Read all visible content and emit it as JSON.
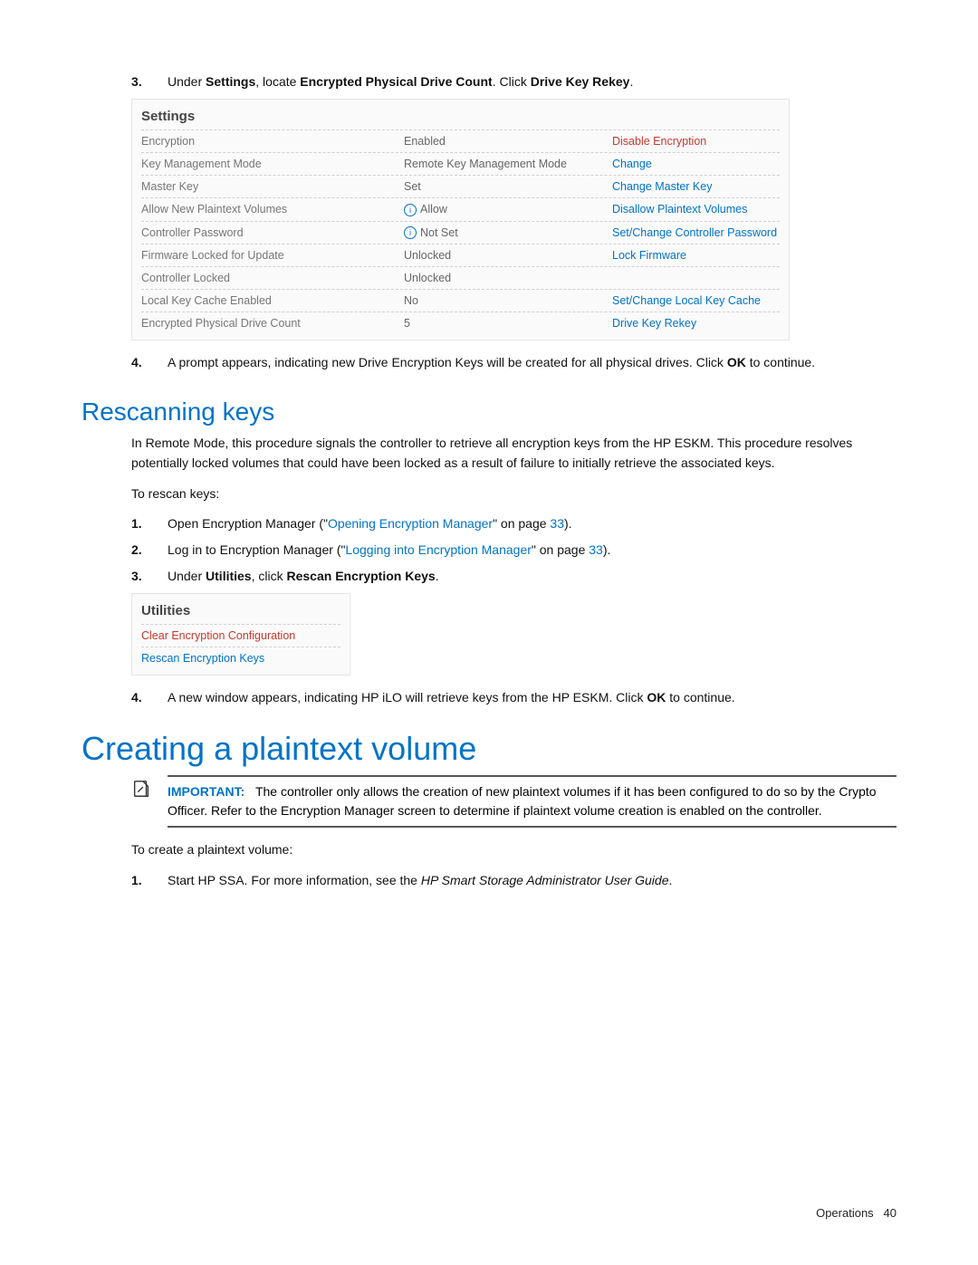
{
  "step3": {
    "num": "3.",
    "pre": "Under ",
    "b1": "Settings",
    "mid": ", locate ",
    "b2": "Encrypted Physical Drive Count",
    "mid2": ". Click ",
    "b3": "Drive Key Rekey",
    "post": "."
  },
  "settings": {
    "title": "Settings",
    "rows": [
      {
        "c1": "Encryption",
        "c2": "Enabled",
        "c3": "Disable Encryption",
        "info": false,
        "red": true
      },
      {
        "c1": "Key Management Mode",
        "c2": "Remote Key Management Mode",
        "c3": "Change",
        "info": false
      },
      {
        "c1": "Master Key",
        "c2": "Set",
        "c3": "Change Master Key",
        "info": false
      },
      {
        "c1": "Allow New Plaintext Volumes",
        "c2": "Allow",
        "c3": "Disallow Plaintext Volumes",
        "info": true
      },
      {
        "c1": "Controller Password",
        "c2": "Not Set",
        "c3": "Set/Change Controller Password",
        "info": true
      },
      {
        "c1": "Firmware Locked for Update",
        "c2": "Unlocked",
        "c3": "Lock Firmware",
        "info": false
      },
      {
        "c1": "Controller Locked",
        "c2": "Unlocked",
        "c3": "",
        "info": false
      },
      {
        "c1": "Local Key Cache Enabled",
        "c2": "No",
        "c3": "Set/Change Local Key Cache",
        "info": false
      },
      {
        "c1": "Encrypted Physical Drive Count",
        "c2": "5",
        "c3": "Drive Key Rekey",
        "info": false
      }
    ]
  },
  "step4a": {
    "num": "4.",
    "text": "A prompt appears, indicating new Drive Encryption Keys will be created for all physical drives. Click ",
    "b": "OK",
    "post": " to continue."
  },
  "rescan": {
    "heading": "Rescanning keys",
    "para": "In Remote Mode, this procedure signals the controller to retrieve all encryption keys from the HP ESKM. This procedure resolves potentially locked volumes that could have been locked as a result of failure to initially retrieve the associated keys.",
    "lead": "To rescan keys:",
    "s1": {
      "num": "1.",
      "pre": "Open Encryption Manager (\"",
      "link": "Opening Encryption Manager",
      "mid": "\" on page ",
      "page": "33",
      "post": ")."
    },
    "s2": {
      "num": "2.",
      "pre": "Log in to Encryption Manager (\"",
      "link": "Logging into Encryption Manager",
      "mid": "\" on page ",
      "page": "33",
      "post": ")."
    },
    "s3": {
      "num": "3.",
      "pre": "Under ",
      "b1": "Utilities",
      "mid": ", click ",
      "b2": "Rescan Encryption Keys",
      "post": "."
    }
  },
  "utilities": {
    "title": "Utilities",
    "rows": [
      {
        "label": "Clear Encryption Configuration",
        "red": true
      },
      {
        "label": "Rescan Encryption Keys",
        "red": false
      }
    ]
  },
  "step4b": {
    "num": "4.",
    "pre": "A new window appears, indicating HP iLO will retrieve keys from the HP ESKM. Click ",
    "b": "OK",
    "post": " to continue."
  },
  "create": {
    "heading": "Creating a plaintext volume",
    "important_label": "IMPORTANT:",
    "important_text": "The controller only allows the creation of new plaintext volumes if it has been configured to do so by the Crypto Officer. Refer to the Encryption Manager screen to determine if plaintext volume creation is enabled on the controller.",
    "lead": "To create a plaintext volume:",
    "s1": {
      "num": "1.",
      "pre": "Start HP SSA. For more information, see the ",
      "it": "HP Smart Storage Administrator User Guide",
      "post": "."
    }
  },
  "footer": {
    "section": "Operations",
    "page": "40"
  }
}
